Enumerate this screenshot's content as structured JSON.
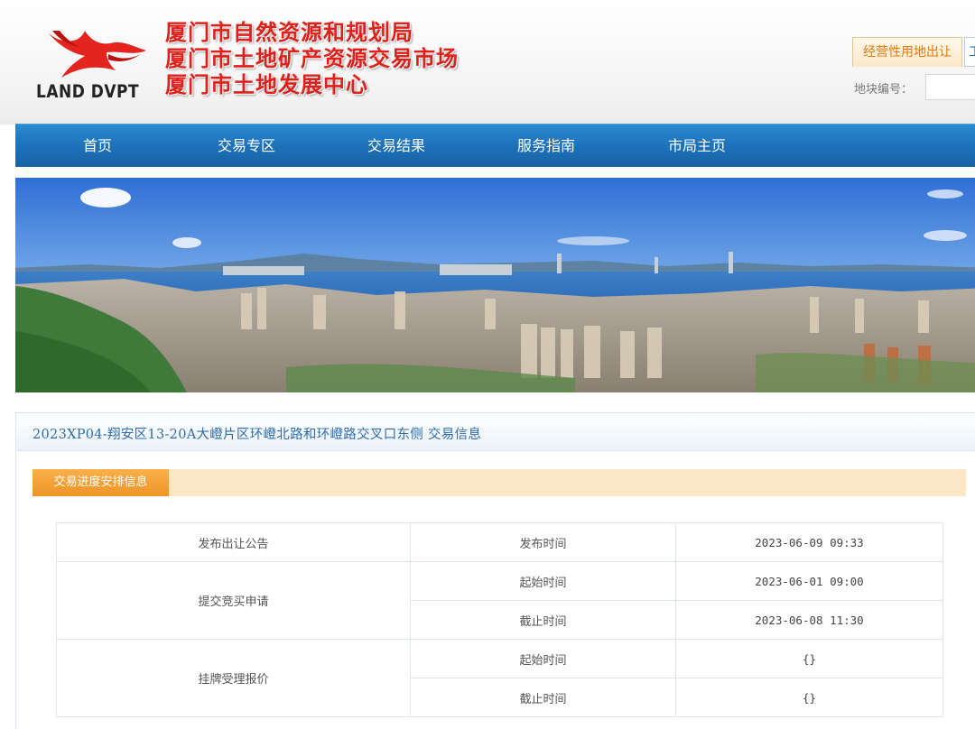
{
  "header": {
    "logo_text": "LAND DVPT",
    "org_lines": [
      "厦门市自然资源和规划局",
      "厦门市土地矿产资源交易市场",
      "厦门市土地发展中心"
    ],
    "tabs": {
      "active": "经营性用地出让",
      "next": "工"
    },
    "search": {
      "label": "地块编号：",
      "value": ""
    }
  },
  "nav": {
    "items": [
      "首页",
      "交易专区",
      "交易结果",
      "服务指南",
      "市局主页"
    ]
  },
  "panel": {
    "title": "2023XP04-翔安区13-20A大嶝片区环嶝北路和环嶝路交叉口东侧 交易信息",
    "section_label": "交易进度安排信息",
    "schedule": {
      "publish": {
        "stage": "发布出让公告",
        "label": "发布时间",
        "value": "2023-06-09 09:33"
      },
      "bid_application": {
        "stage": "提交竞买申请",
        "start_label": "起始时间",
        "start_value": "2023-06-01 09:00",
        "end_label": "截止时间",
        "end_value": "2023-06-08 11:30"
      },
      "listing": {
        "stage": "挂牌受理报价",
        "start_label": "起始时间",
        "start_value": "{}",
        "end_label": "截止时间",
        "end_value": "{}"
      }
    }
  },
  "colors": {
    "nav_blue": "#1c70b8",
    "brand_red": "#e0201b",
    "accent_orange": "#ef9426",
    "title_blue": "#2a6cb0"
  },
  "icons": {
    "logo": "red-bird-logo-icon"
  }
}
